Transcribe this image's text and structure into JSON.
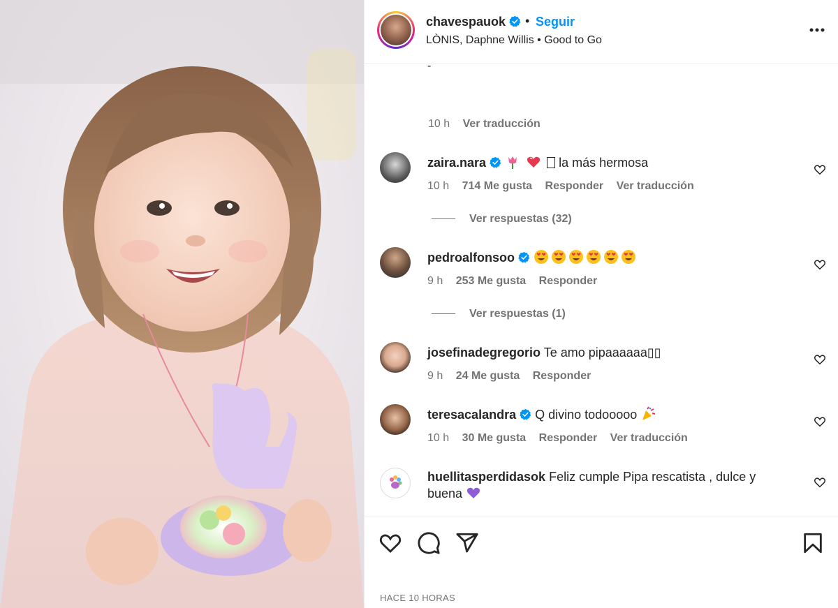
{
  "post": {
    "username": "chavespauok",
    "follow_label": "Seguir",
    "separator": "•",
    "audio": "LÒNIS, Daphne Willis • Good to Go",
    "caption_tail": "-",
    "caption_time": "10 h",
    "caption_translate": "Ver traducción",
    "posted": "HACE 10 HORAS"
  },
  "comments": [
    {
      "user": "zaira.nara",
      "text": " la más hermosa",
      "emojis": [
        "tulip",
        "heart-pink",
        "box"
      ],
      "time": "10 h",
      "likes": "714 Me gusta",
      "reply": "Responder",
      "translate": "Ver traducción",
      "replies": "Ver respuestas (32)"
    },
    {
      "user": "pedroalfonsoo",
      "text": "",
      "emojis": [
        "heart-eyes",
        "heart-eyes",
        "heart-eyes",
        "heart-eyes",
        "heart-eyes",
        "heart-eyes"
      ],
      "time": "9 h",
      "likes": "253 Me gusta",
      "reply": "Responder",
      "replies": "Ver respuestas (1)"
    },
    {
      "user": "josefinadegregorio",
      "text": "Te amo pipaaaaaa▯▯",
      "time": "9 h",
      "likes": "24 Me gusta",
      "reply": "Responder"
    },
    {
      "user": "teresacalandra",
      "text": "Q divino todooooo",
      "emojis": [
        "party"
      ],
      "time": "10 h",
      "likes": "30 Me gusta",
      "reply": "Responder",
      "translate": "Ver traducción"
    },
    {
      "user": "huellitasperdidasok",
      "text": "Feliz cumple Pipa rescatista , dulce y buena",
      "emojis": [
        "purple-heart"
      ]
    }
  ],
  "icons": {
    "verified": "verified-badge-icon",
    "more": "more-options-icon",
    "heart": "heart-icon",
    "comment": "comment-icon",
    "share": "share-icon",
    "save": "bookmark-icon"
  },
  "colors": {
    "link": "#0095f6",
    "verified": "#0095f6",
    "muted": "#737373"
  }
}
